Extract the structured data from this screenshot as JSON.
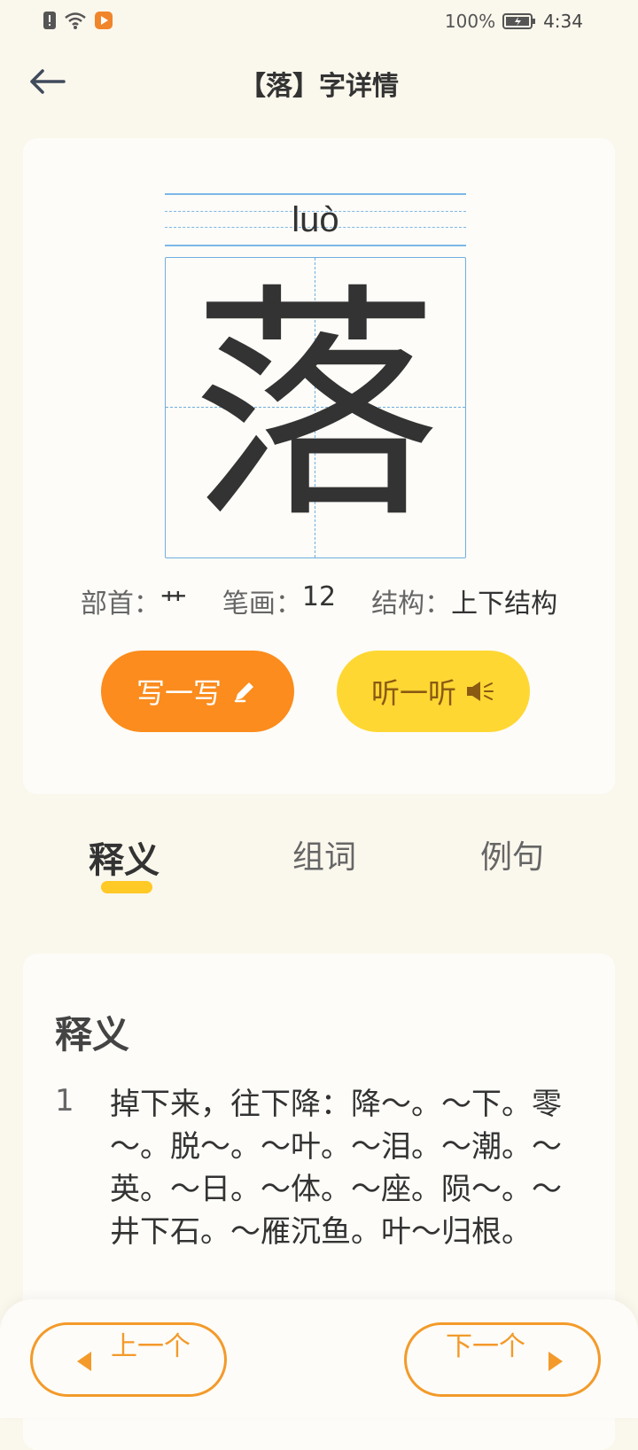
{
  "status_bar": {
    "battery_percent": "100%",
    "time": "4:34",
    "icons": [
      "alert-icon",
      "wifi-icon",
      "app-notification-icon",
      "battery-charging-icon"
    ]
  },
  "header": {
    "title": "【落】字详情",
    "back_icon": "arrow-left-icon"
  },
  "character": {
    "pinyin": "luò",
    "glyph": "落",
    "radical_label": "部首：",
    "radical_value": "艹",
    "strokes_label": "笔画：",
    "strokes_value": "12",
    "structure_label": "结构：",
    "structure_value": "上下结构"
  },
  "actions": {
    "write_label": "写一写",
    "write_icon": "pencil-icon",
    "listen_label": "听一听",
    "listen_icon": "speaker-icon"
  },
  "tabs": [
    {
      "label": "释义",
      "active": true
    },
    {
      "label": "组词",
      "active": false
    },
    {
      "label": "例句",
      "active": false
    }
  ],
  "definition": {
    "title": "释义",
    "items": [
      {
        "num": "1",
        "text": "掉下来，往下降：降～。～下。零～。脱～。～叶。～泪。～潮。～英。～日。～体。～座。陨～。～井下石。～雁沉鱼。叶～归根。"
      }
    ]
  },
  "bottom_nav": {
    "prev_label": "上一个",
    "next_label": "下一个"
  },
  "colors": {
    "background": "#FAF7EC",
    "card": "#FDFCF8",
    "write_button": "#FB8C1D",
    "listen_button": "#FFD733",
    "grid_line": "#6FAFE0",
    "tab_indicator": "#FFC926",
    "nav_outline": "#F39A2A"
  }
}
